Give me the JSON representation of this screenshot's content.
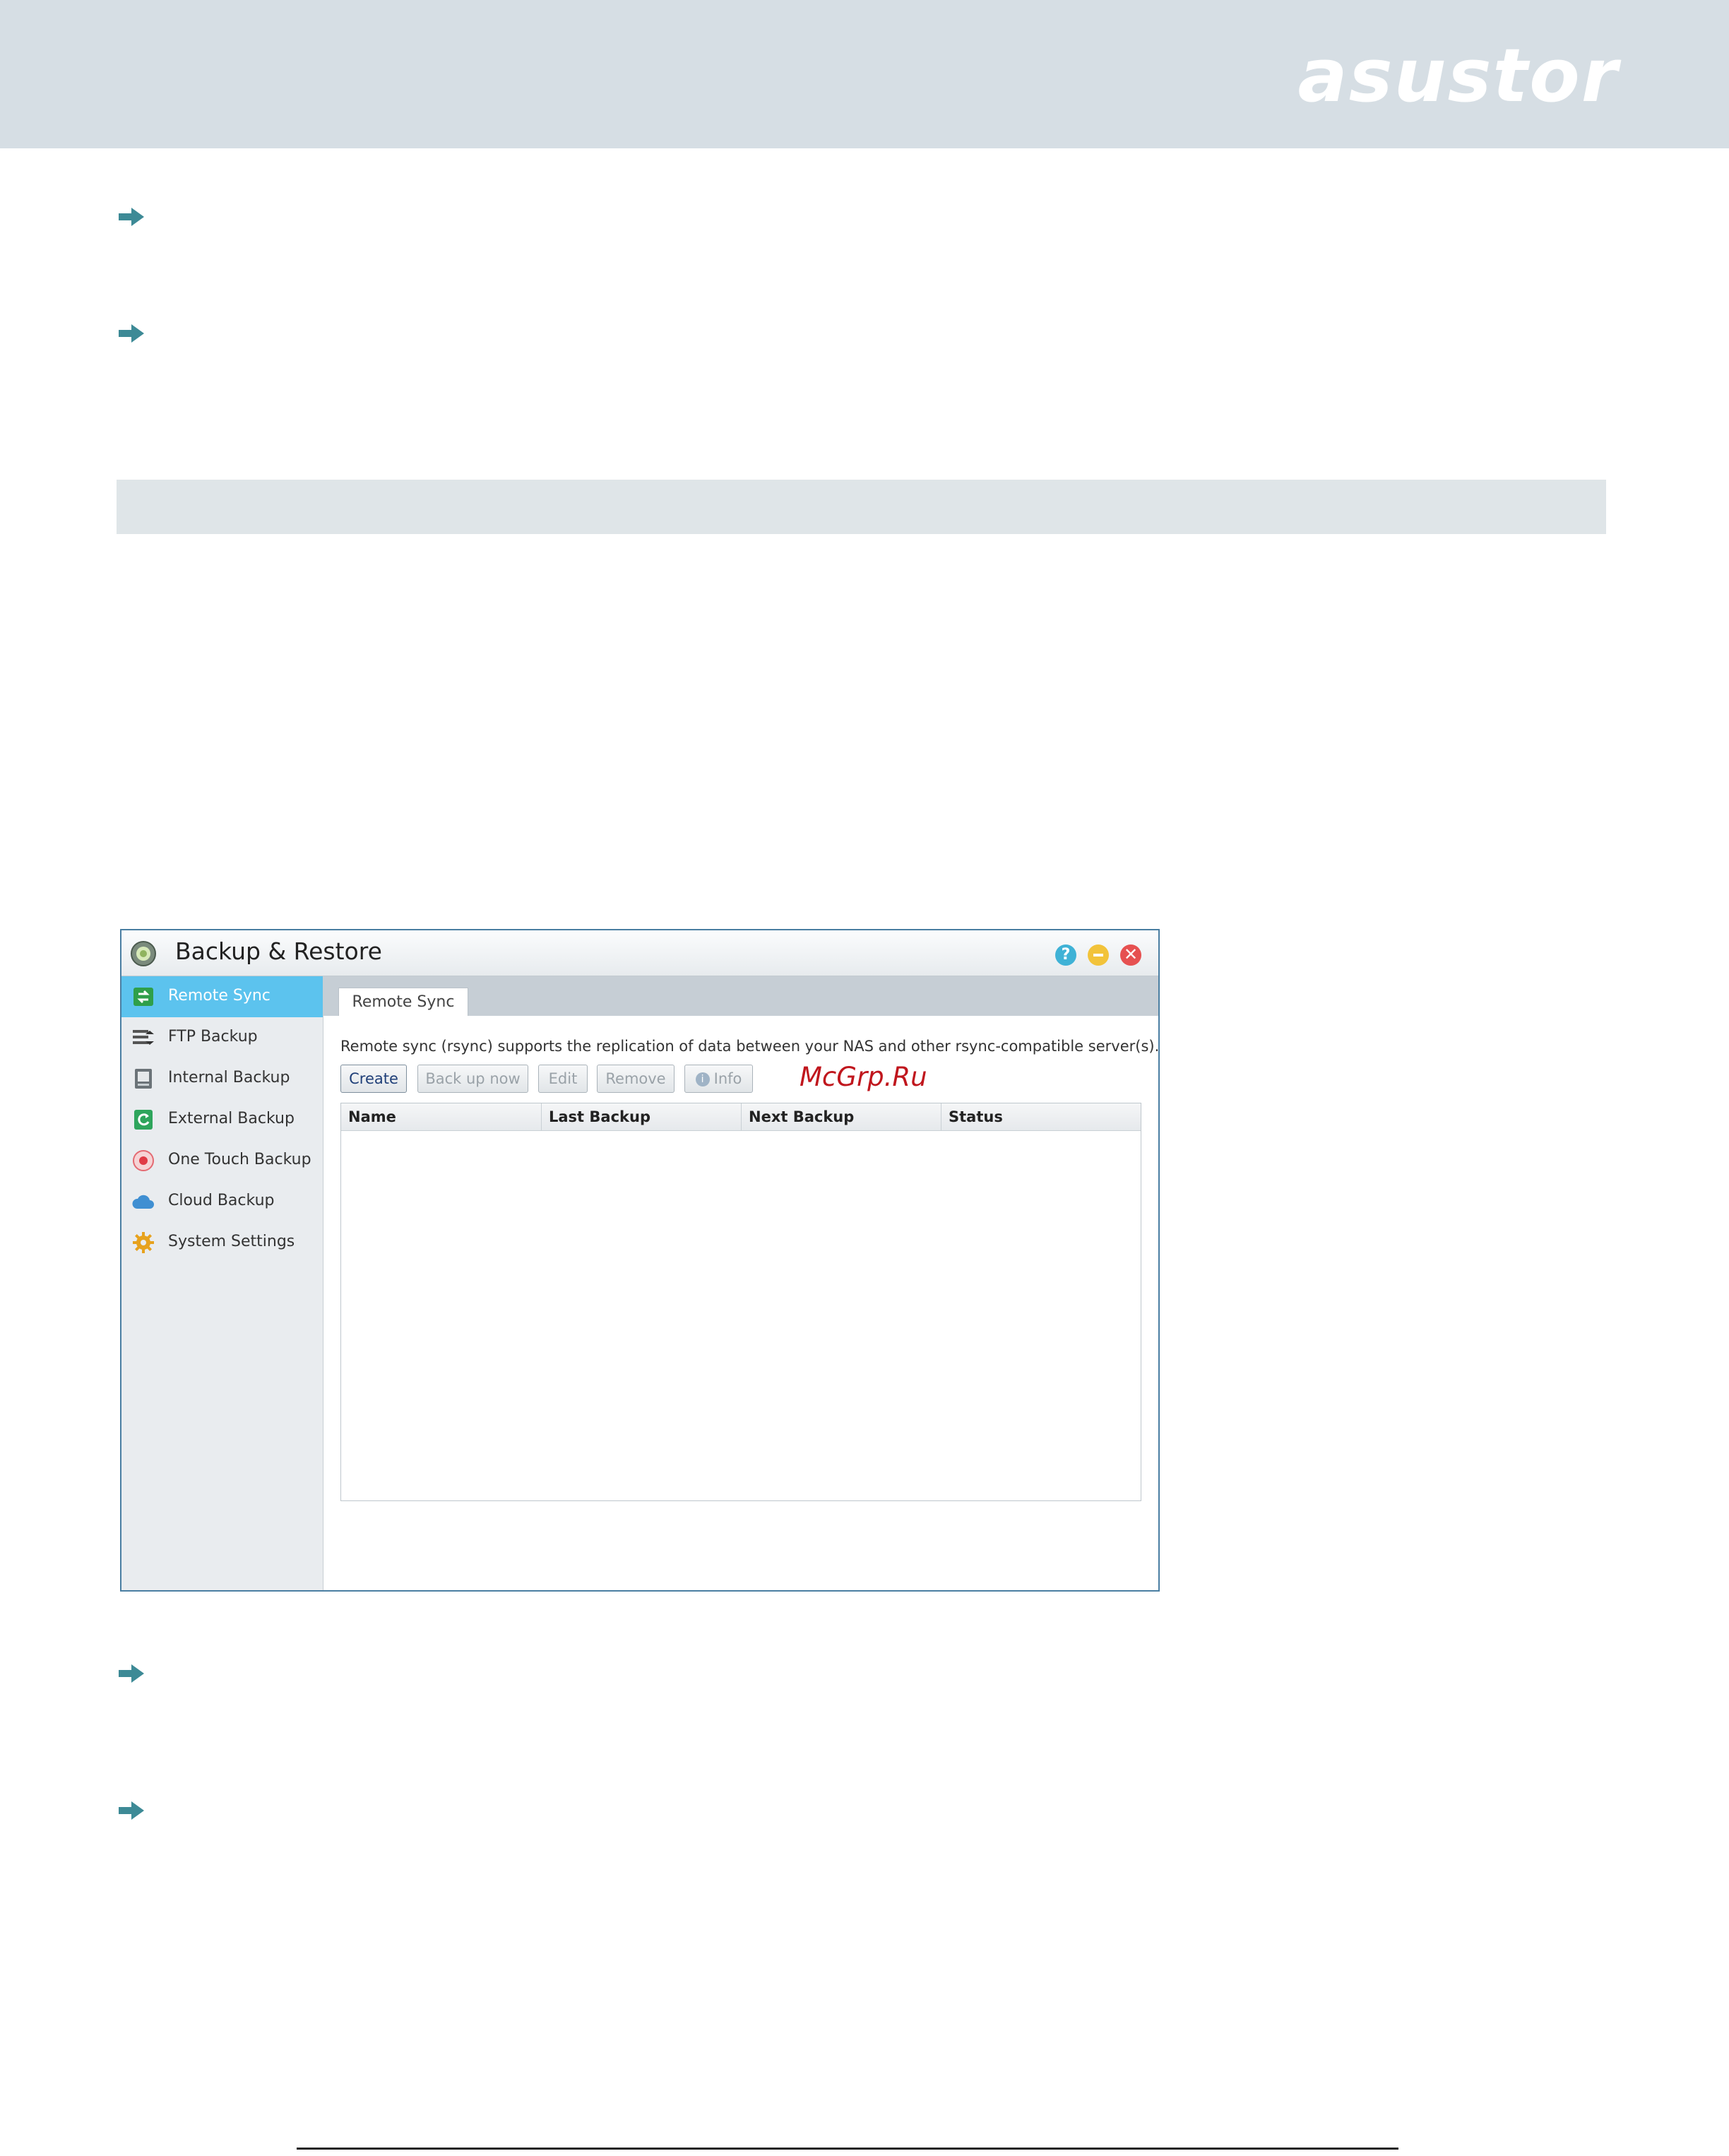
{
  "brand": {
    "logo_text": "asustor",
    "header_color": "#d6dee4",
    "accent_arrow_color": "#3d8a96"
  },
  "window": {
    "title": "Backup & Restore",
    "help_label": "?",
    "close_label": "✕",
    "sidebar": [
      {
        "label": "Remote Sync",
        "icon": "remote-sync-icon",
        "active": true
      },
      {
        "label": "FTP Backup",
        "icon": "ftp-backup-icon"
      },
      {
        "label": "Internal Backup",
        "icon": "internal-backup-icon"
      },
      {
        "label": "External Backup",
        "icon": "external-backup-icon"
      },
      {
        "label": "One Touch Backup",
        "icon": "one-touch-backup-icon"
      },
      {
        "label": "Cloud Backup",
        "icon": "cloud-backup-icon"
      },
      {
        "label": "System Settings",
        "icon": "gear-icon"
      }
    ],
    "tab": "Remote Sync",
    "description": "Remote sync (rsync) supports the replication of data between your NAS and other rsync-compatible server(s).",
    "toolbar": {
      "create": "Create",
      "backup_now": "Back up now",
      "edit": "Edit",
      "remove": "Remove",
      "info": "Info",
      "info_glyph": "i"
    },
    "table": {
      "columns": [
        "Name",
        "Last Backup",
        "Next Backup",
        "Status"
      ],
      "rows": []
    }
  },
  "watermark": "McGrp.Ru"
}
